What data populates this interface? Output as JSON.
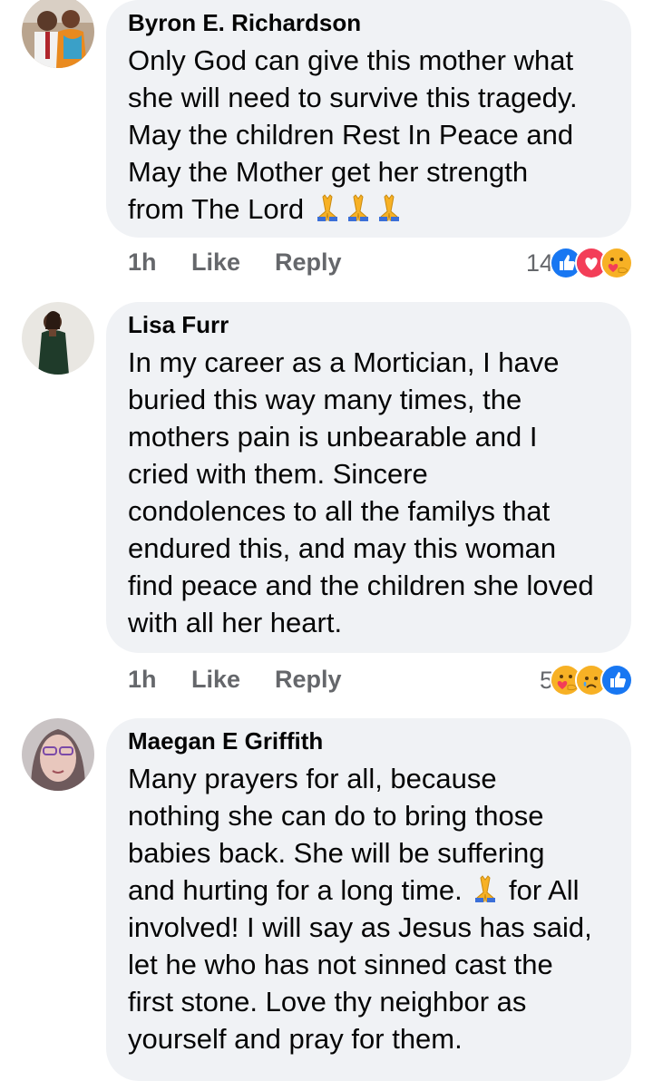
{
  "comments": [
    {
      "author": "Byron E. Richardson",
      "text_lines": [
        "Only God can give this mother what",
        "she will need to survive this tragedy.",
        "May the children Rest In Peace and",
        "May the Mother get her strength",
        "from The Lord"
      ],
      "emoji_suffix": [
        "folded-hands-emoji",
        "folded-hands-emoji",
        "folded-hands-emoji"
      ],
      "time": "1h",
      "like_label": "Like",
      "reply_label": "Reply",
      "reaction_count": "14",
      "reactions": [
        "like-reaction",
        "love-reaction",
        "care-reaction"
      ]
    },
    {
      "author": "Lisa Furr",
      "text_lines": [
        "In my career as a Mortician, I have",
        "buried this way many times, the",
        "mothers pain is unbearable and I",
        "cried with them. Sincere",
        "condolences to all the familys that",
        "endured this, and may this woman",
        "find peace and the children she loved",
        "with all her heart."
      ],
      "time": "1h",
      "like_label": "Like",
      "reply_label": "Reply",
      "reaction_count": "5",
      "reactions": [
        "care-reaction",
        "sad-reaction",
        "like-reaction"
      ]
    },
    {
      "author": "Maegan E Griffith",
      "text_lines": [
        "Many prayers for all,  because",
        "nothing she can do to bring those",
        "babies back.  She will be suffering",
        "and hurting for a long time.",
        "for All",
        "involved! I will say as Jesus has said,",
        "let he who has not sinned cast the",
        "first stone. Love thy neighbor as",
        "yourself and pray for them."
      ],
      "inline_emoji": "folded-hands-emoji"
    }
  ],
  "colors": {
    "bubble": "#f0f2f5",
    "secondary_text": "#65676b",
    "like_blue": "#1877f2",
    "love_red": "#f33e58",
    "care_yellow": "#f7b125"
  }
}
